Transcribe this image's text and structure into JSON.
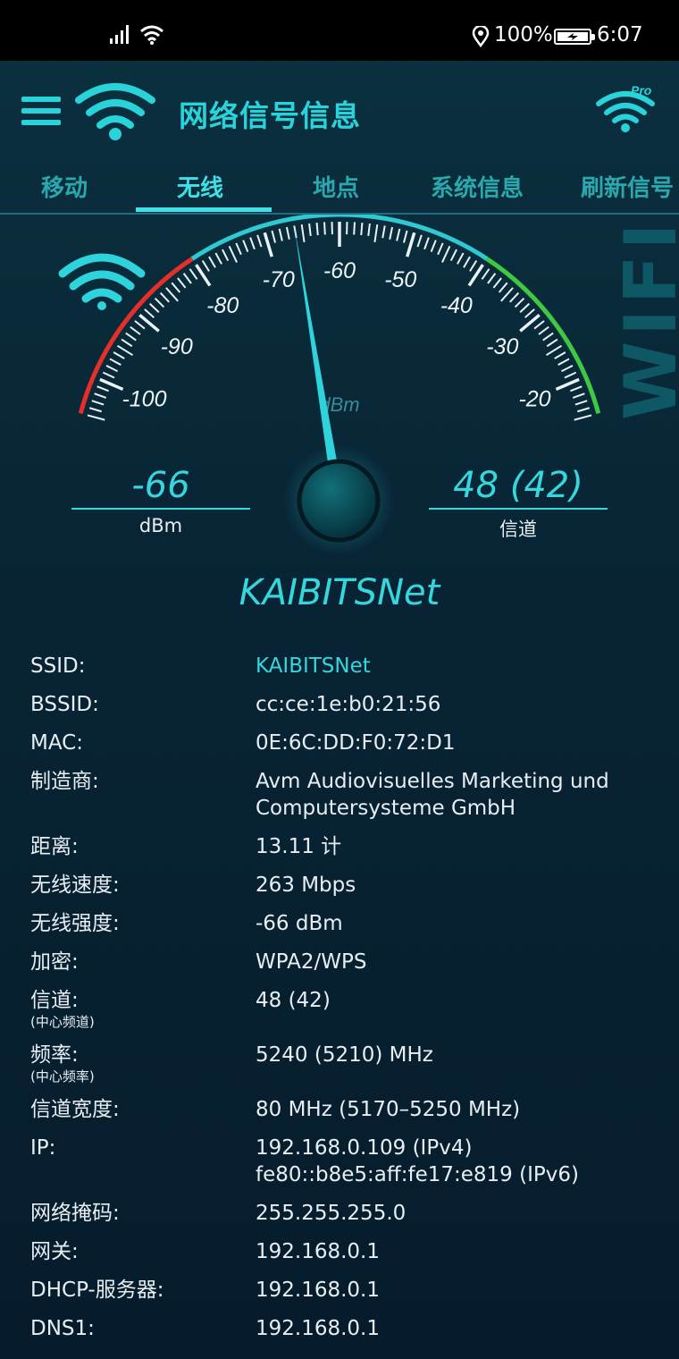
{
  "status_bar": {
    "battery": "100%",
    "time": "6:07"
  },
  "app": {
    "title": "网络信号信息",
    "tabs": [
      {
        "label": "移动"
      },
      {
        "label": "无线"
      },
      {
        "label": "地点"
      },
      {
        "label": "系统信息"
      },
      {
        "label": "刷新信号"
      }
    ],
    "active_tab": "无线"
  },
  "gauge": {
    "watermark": "WIFI",
    "unit": "dBm",
    "scale_labels": [
      "-100",
      "-90",
      "-80",
      "-70",
      "-60",
      "-50",
      "-40",
      "-30",
      "-20"
    ],
    "range": [
      -105,
      -15
    ],
    "value_dbm": -66,
    "needle_color": "#2fd3db",
    "arc_colors": {
      "low": "#e52f2a",
      "mid": "#2fc9d2",
      "high": "#3fc842"
    }
  },
  "readouts": {
    "signal_value": "-66",
    "signal_unit": "dBm",
    "channel_value": "48 (42)",
    "channel_label": "信道"
  },
  "network_name": "KAIBITSNet",
  "info": [
    {
      "key": "SSID:",
      "value": "KAIBITSNet",
      "accent": true
    },
    {
      "key": "BSSID:",
      "value": "cc:ce:1e:b0:21:56"
    },
    {
      "key": "MAC:",
      "value": "0E:6C:DD:F0:72:D1"
    },
    {
      "key": "制造商:",
      "value": "Avm Audiovisuelles Marketing und",
      "value2": "Computersysteme GmbH"
    },
    {
      "key": "距离:",
      "value": "13.11 计"
    },
    {
      "key": "无线速度:",
      "value": "263 Mbps"
    },
    {
      "key": "无线强度:",
      "value": "-66 dBm"
    },
    {
      "key": "加密:",
      "value": "WPA2/WPS"
    },
    {
      "key": "信道:",
      "sub": "(中心频道)",
      "value": "48 (42)"
    },
    {
      "key": "频率:",
      "sub": "(中心频率)",
      "value": "5240 (5210) MHz"
    },
    {
      "key": "信道宽度:",
      "value": "80 MHz (5170–5250 MHz)"
    },
    {
      "key": "IP:",
      "value": "192.168.0.109 (IPv4)",
      "value2": "fe80::b8e5:aff:fe17:e819 (IPv6)"
    },
    {
      "key": "网络掩码:",
      "value": "255.255.255.0"
    },
    {
      "key": "网关:",
      "value": "192.168.0.1"
    },
    {
      "key": "DHCP-服务器:",
      "value": "192.168.0.1"
    },
    {
      "key": "DNS1:",
      "value": "192.168.0.1"
    }
  ]
}
